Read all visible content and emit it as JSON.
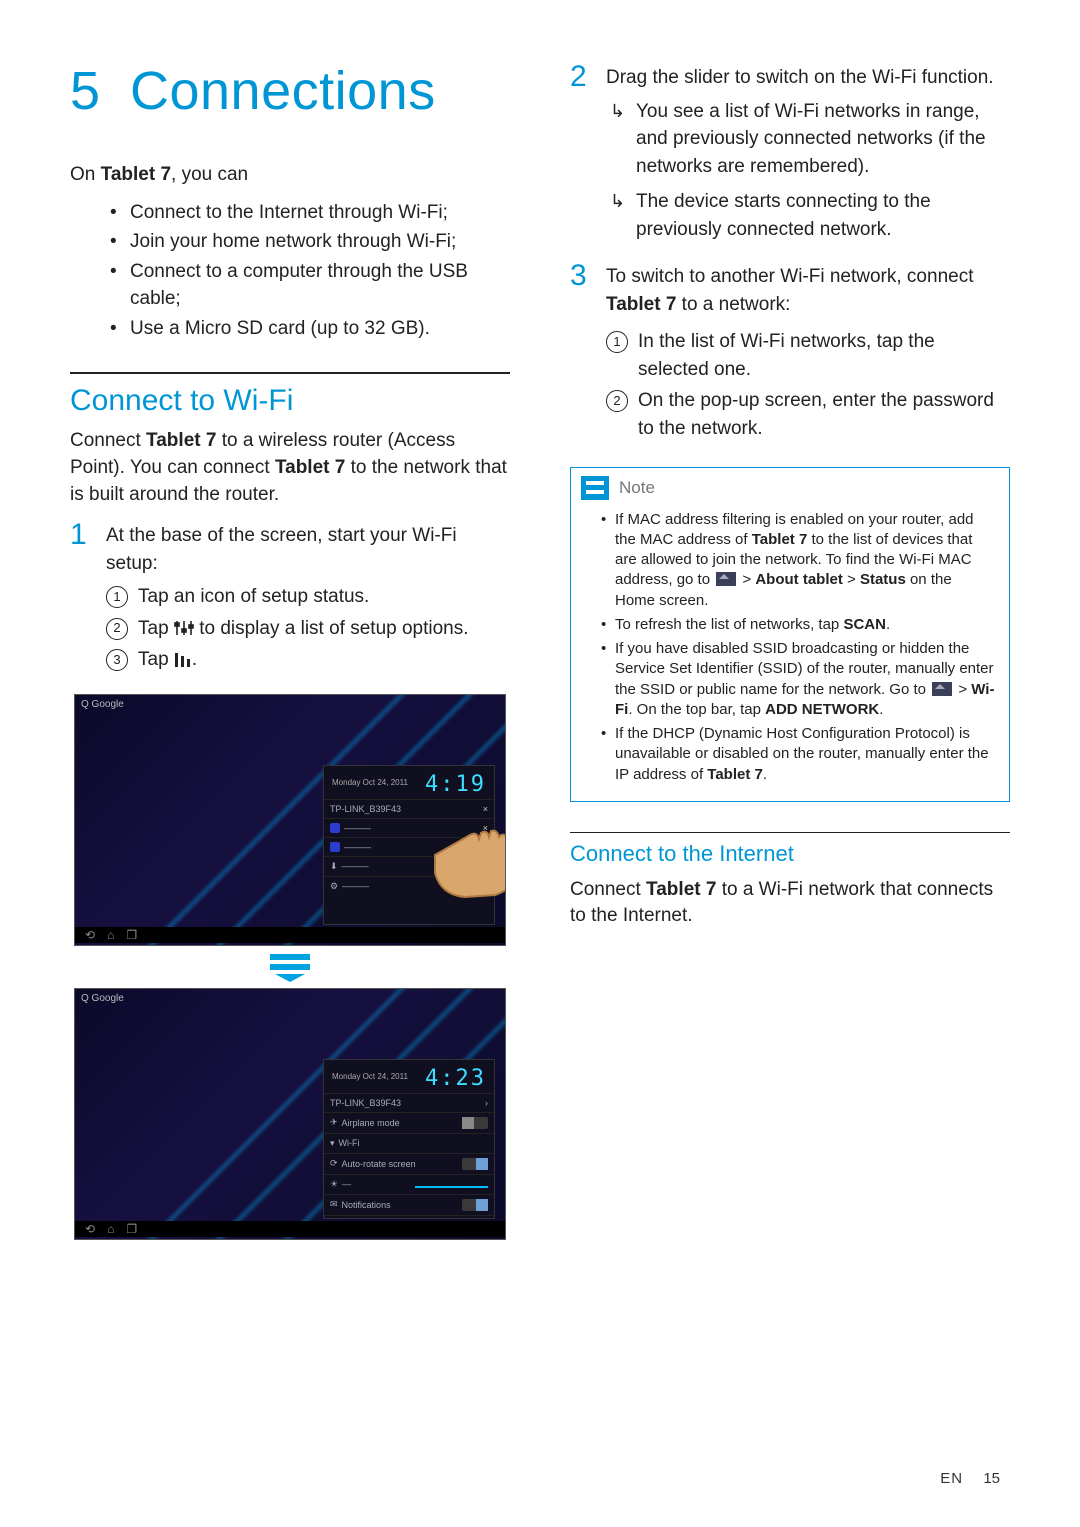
{
  "chapter": {
    "num": "5",
    "title": "Connections"
  },
  "intro": {
    "lead": "On ",
    "device": "Tablet 7",
    "lead_tail": ", you can",
    "bullets": [
      "Connect to the Internet through Wi-Fi;",
      "Join your home network through Wi-Fi;",
      "Connect to a computer through the USB cable;",
      "Use a Micro SD card (up to 32 GB)."
    ]
  },
  "wifi_section": {
    "title": "Connect to Wi-Fi",
    "para_a": "Connect ",
    "device": "Tablet 7",
    "para_b": " to a wireless router (Access Point). You can connect ",
    "para_c": " to the network that is built around the router."
  },
  "step1": {
    "num": "1",
    "text": "At the base of the screen, start your Wi-Fi setup:",
    "sub": [
      "Tap an icon of setup status.",
      "Tap ",
      " to display a list of setup options.",
      "Tap ",
      "."
    ]
  },
  "step2": {
    "num": "2",
    "text": "Drag the slider to switch on the Wi-Fi function.",
    "results": [
      "You see a list of Wi-Fi networks in range, and previously connected networks (if the networks are remembered).",
      "The device starts connecting to the previously connected network."
    ]
  },
  "step3": {
    "num": "3",
    "text_a": "To switch to another Wi-Fi network, connect ",
    "device": "Tablet 7",
    "text_b": " to a network:",
    "sub": [
      "In the list of Wi-Fi networks, tap the selected one.",
      "On the pop-up screen, enter the password to the network."
    ]
  },
  "note": {
    "title": "Note",
    "items": {
      "i1a": "If MAC address filtering is enabled on your router, add the MAC address of ",
      "i1_dev": "Tablet 7",
      "i1b": " to the list of devices that are allowed to join the network. To find the Wi-Fi MAC address, go to ",
      "i1c": " > ",
      "i1_about": "About tablet",
      "i1d": " > ",
      "i1_status": "Status",
      "i1e": " on the Home screen.",
      "i2a": "To refresh the list of networks, tap ",
      "i2_scan": "SCAN",
      "i2b": ".",
      "i3a": "If you have disabled SSID broadcasting or hidden the Service Set Identifier (SSID) of the router, manually enter the SSID or public name for the network. Go to ",
      "i3b": " > ",
      "i3_wifi": "Wi-Fi",
      "i3c": ". On the top bar, tap ",
      "i3_add": "ADD NETWORK",
      "i3d": ".",
      "i4a": "If the DHCP (Dynamic Host Configuration Protocol) is unavailable or disabled on the router, manually enter the IP address of ",
      "i4_dev": "Tablet 7",
      "i4b": "."
    }
  },
  "internet_section": {
    "title": "Connect to the Internet",
    "p_a": "Connect ",
    "device": "Tablet 7",
    "p_b": " to a Wi-Fi network that connects to the Internet."
  },
  "screens": {
    "search": "Q  Google",
    "date": "Monday\nOct 24, 2011",
    "clock1": "4:19",
    "clock2": "4:23",
    "wifi_row": "TP-LINK_B39F43",
    "airplane": "Airplane mode",
    "wifi_label": "Wi-Fi",
    "autorotate": "Auto-rotate screen",
    "notifications": "Notifications",
    "settings": "Settings"
  },
  "footer": {
    "lang": "EN",
    "page": "15"
  }
}
